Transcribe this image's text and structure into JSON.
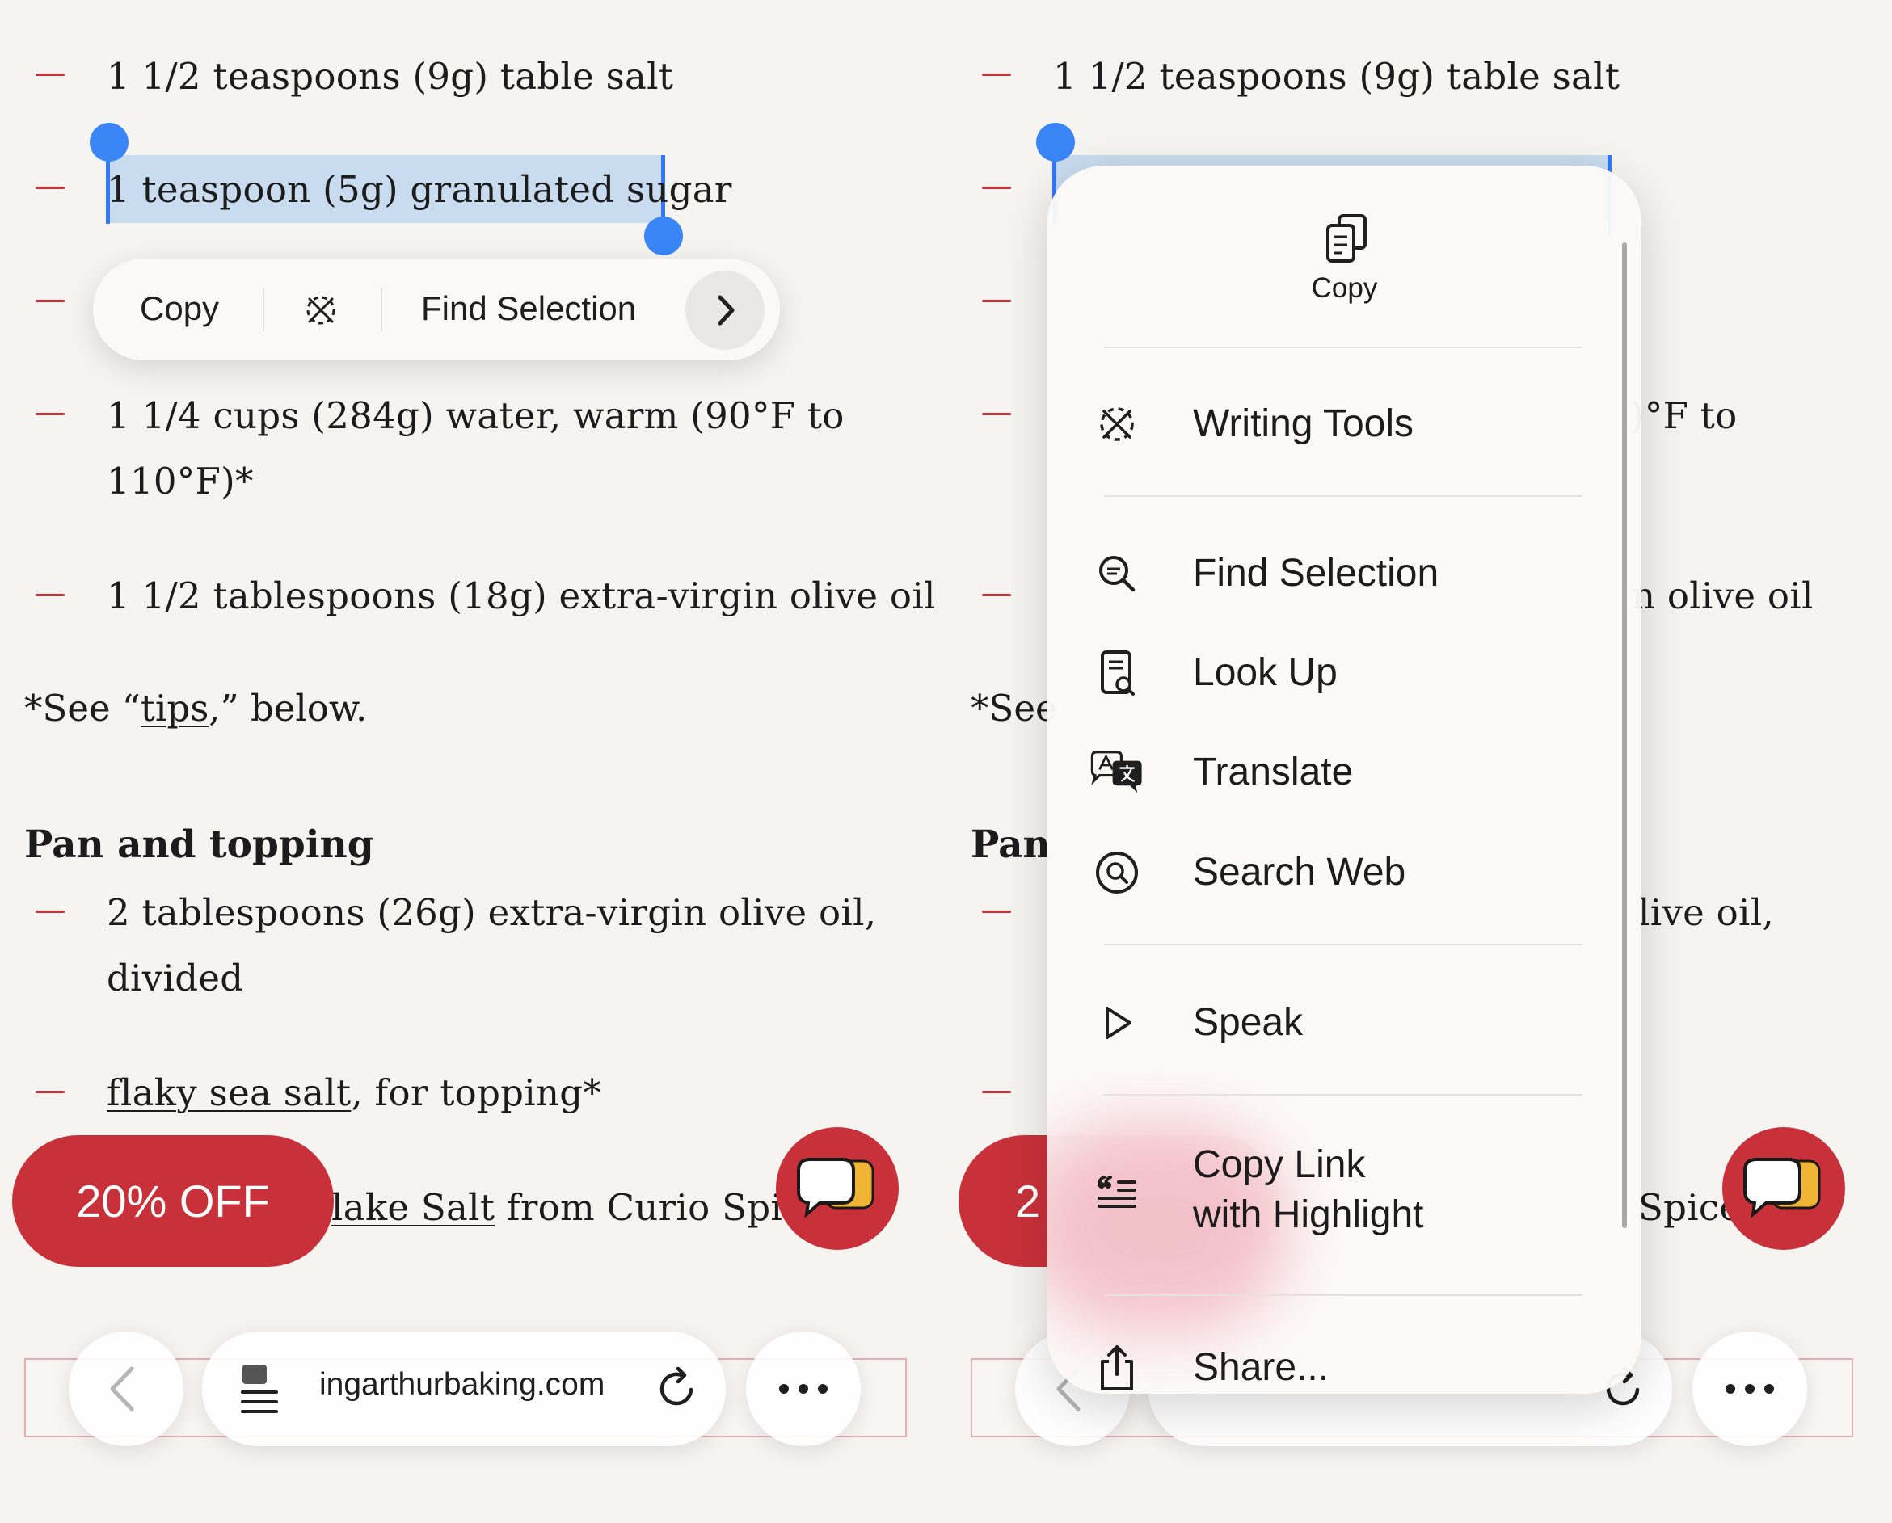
{
  "ingredients": {
    "salt": "1 1/2 teaspoons (9g) table salt",
    "sugar": "1 teaspoon (5g) granulated sugar",
    "water_line1": "1 1/4 cups (284g) water, warm (90°F to",
    "water_line2": "110°F)*",
    "oil": "1 1/2 tablespoons (18g) extra-virgin olive oil"
  },
  "note": {
    "prefix": "*See “",
    "link": "tips",
    "suffix": ",” below."
  },
  "pan_section": {
    "heading": "Pan and topping",
    "oil_line1": "2 tablespoons (26g) extra-virgin olive oil,",
    "oil_line2": "divided",
    "salt_link": "flaky sea salt",
    "salt_rest": ", for topping*",
    "flake_link": "lake Salt",
    "flake_rest": " from Curio Spice"
  },
  "edit_menu": {
    "copy": "Copy",
    "find": "Find Selection"
  },
  "promo": {
    "label": "20% OFF",
    "label_partial": "2"
  },
  "toolbar": {
    "url": "ingarthurbaking.com"
  },
  "right_panel": {
    "partial_water": ")°F to",
    "partial_oil": "n olive oil",
    "partial_note": "*See",
    "partial_heading": "Pan",
    "partial_pan_oil": "live oil,",
    "partial_spice": "Spice"
  },
  "context_menu": {
    "copy": "Copy",
    "writing_tools": "Writing Tools",
    "find_selection": "Find Selection",
    "look_up": "Look Up",
    "translate": "Translate",
    "search_web": "Search Web",
    "speak": "Speak",
    "copy_link_line1": "Copy Link",
    "copy_link_line2": "with Highlight",
    "share": "Share..."
  },
  "colors": {
    "accent_red": "#c9313a",
    "selection_blue": "#3a86f7",
    "selection_fill": "#c9dcef",
    "page_bg": "#f6f4f1"
  },
  "icons": [
    "copy-icon",
    "writing-tools-icon",
    "chevron-right-icon",
    "find-icon",
    "look-up-icon",
    "translate-icon",
    "search-web-icon",
    "speak-icon",
    "copy-link-icon",
    "share-icon",
    "back-icon",
    "reader-icon",
    "reload-icon",
    "more-icon",
    "chat-icon"
  ]
}
